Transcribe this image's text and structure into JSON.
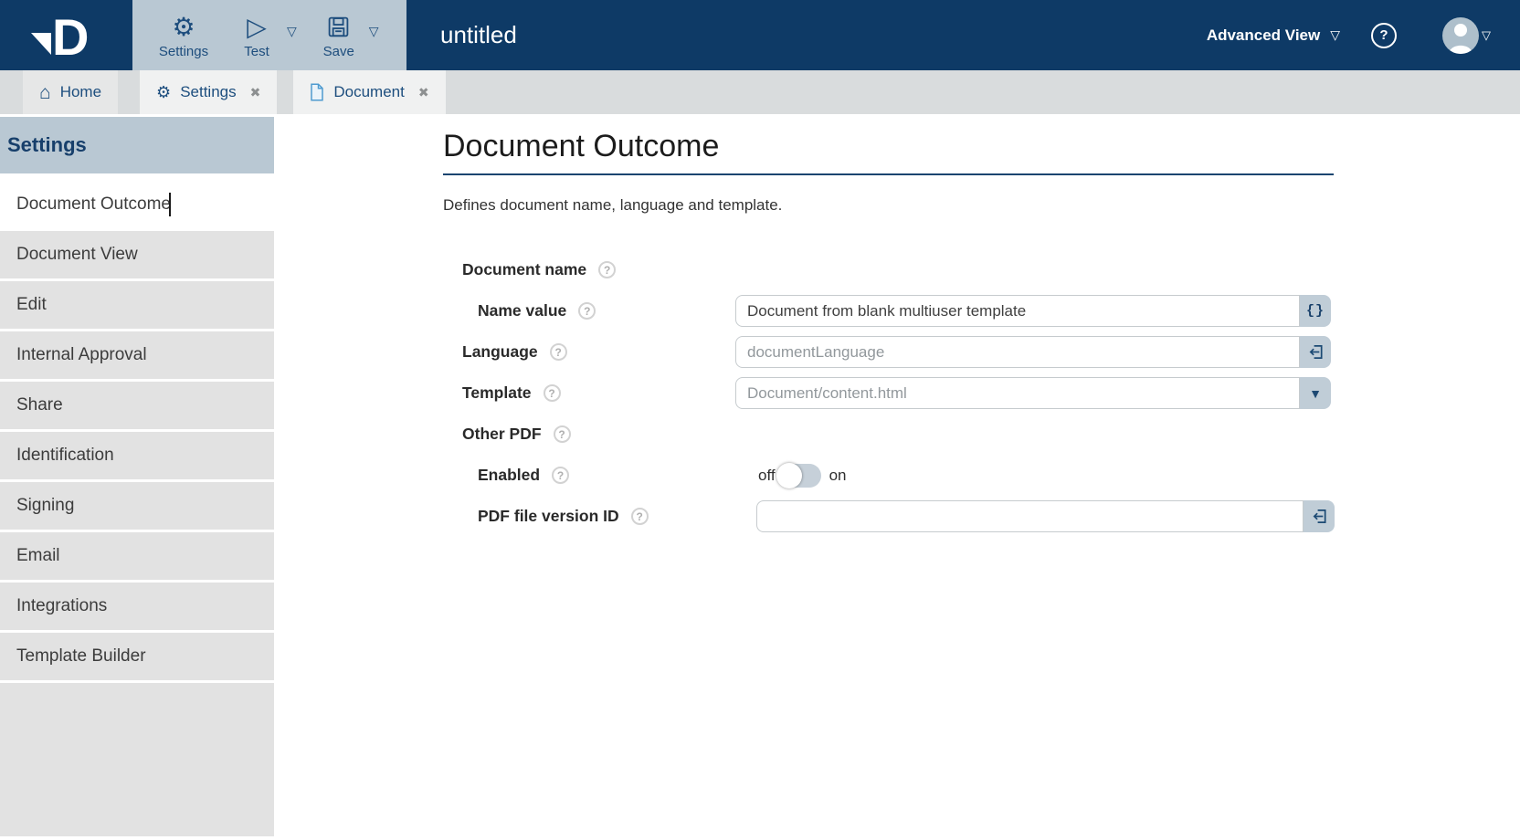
{
  "header": {
    "document_title": "untitled",
    "toolbar": {
      "settings_label": "Settings",
      "test_label": "Test",
      "save_label": "Save"
    },
    "view_mode": "Advanced View"
  },
  "icons": {
    "gear": "⚙",
    "play": "▷",
    "caret_down": "▽",
    "home": "⌂",
    "close": "✖",
    "help": "?",
    "dropdown": "▼",
    "braces": "{}"
  },
  "tab_bar": {
    "tabs": [
      {
        "label": "Home",
        "icon": "home-icon",
        "closable": false
      },
      {
        "label": "Settings",
        "icon": "gear-icon",
        "closable": true
      },
      {
        "label": "Document",
        "icon": "document-icon",
        "closable": true
      }
    ]
  },
  "sidebar": {
    "heading": "Settings",
    "items": [
      {
        "label": "Document Outcome",
        "active": true
      },
      {
        "label": "Document View",
        "active": false
      },
      {
        "label": "Edit",
        "active": false
      },
      {
        "label": "Internal Approval",
        "active": false
      },
      {
        "label": "Share",
        "active": false
      },
      {
        "label": "Identification",
        "active": false
      },
      {
        "label": "Signing",
        "active": false
      },
      {
        "label": "Email",
        "active": false
      },
      {
        "label": "Integrations",
        "active": false
      },
      {
        "label": "Template Builder",
        "active": false
      }
    ]
  },
  "main": {
    "title": "Document Outcome",
    "subtitle": "Defines document name, language and template.",
    "fields": {
      "document_name": {
        "label": "Document name"
      },
      "name_value": {
        "label": "Name value",
        "value": "Document from blank multiuser template"
      },
      "language": {
        "label": "Language",
        "placeholder": "documentLanguage"
      },
      "template": {
        "label": "Template",
        "value": "Document/content.html"
      },
      "other_pdf": {
        "label": "Other PDF"
      },
      "enabled": {
        "label": "Enabled",
        "off_label": "off",
        "on_label": "on",
        "state": "off"
      },
      "pdf_file_version_id": {
        "label": "PDF file version ID",
        "value": ""
      }
    }
  },
  "colors": {
    "header_bg": "#0e3a66",
    "steel": "#b9c8d3",
    "navy_icon": "#1d4d7d",
    "tab_text": "#1d4e7e",
    "underline": "#1a4570",
    "sidebar_item_bg": "#e2e2e2"
  }
}
